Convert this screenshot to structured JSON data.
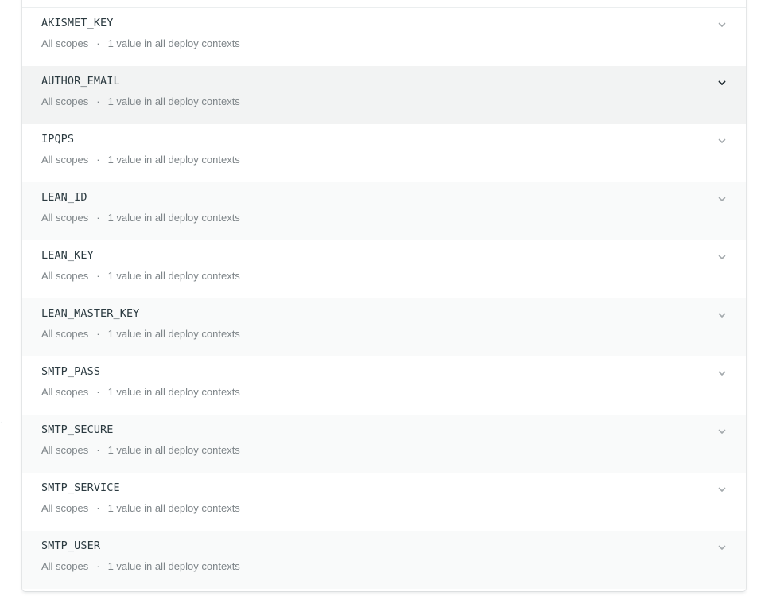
{
  "variables": [
    {
      "key": "AKISMET_KEY",
      "scopes": "All scopes",
      "separator": "·",
      "values": "1 value in all deploy contexts",
      "expand_icon": "chevron-down-icon"
    },
    {
      "key": "AUTHOR_EMAIL",
      "scopes": "All scopes",
      "separator": "·",
      "values": "1 value in all deploy contexts",
      "expand_icon": "chevron-down-icon"
    },
    {
      "key": "IPQPS",
      "scopes": "All scopes",
      "separator": "·",
      "values": "1 value in all deploy contexts",
      "expand_icon": "chevron-down-icon"
    },
    {
      "key": "LEAN_ID",
      "scopes": "All scopes",
      "separator": "·",
      "values": "1 value in all deploy contexts",
      "expand_icon": "chevron-down-icon"
    },
    {
      "key": "LEAN_KEY",
      "scopes": "All scopes",
      "separator": "·",
      "values": "1 value in all deploy contexts",
      "expand_icon": "chevron-down-icon"
    },
    {
      "key": "LEAN_MASTER_KEY",
      "scopes": "All scopes",
      "separator": "·",
      "values": "1 value in all deploy contexts",
      "expand_icon": "chevron-down-icon"
    },
    {
      "key": "SMTP_PASS",
      "scopes": "All scopes",
      "separator": "·",
      "values": "1 value in all deploy contexts",
      "expand_icon": "chevron-down-icon"
    },
    {
      "key": "SMTP_SECURE",
      "scopes": "All scopes",
      "separator": "·",
      "values": "1 value in all deploy contexts",
      "expand_icon": "chevron-down-icon"
    },
    {
      "key": "SMTP_SERVICE",
      "scopes": "All scopes",
      "separator": "·",
      "values": "1 value in all deploy contexts",
      "expand_icon": "chevron-down-icon"
    },
    {
      "key": "SMTP_USER",
      "scopes": "All scopes",
      "separator": "·",
      "values": "1 value in all deploy contexts",
      "expand_icon": "chevron-down-icon"
    }
  ],
  "hovered_row": "AUTHOR_EMAIL",
  "colors": {
    "row_hover": "#f2f3f3",
    "row_alt": "#f9fafa",
    "chevron": "#a3a9ac",
    "chevron_hover": "#1f2a30"
  }
}
